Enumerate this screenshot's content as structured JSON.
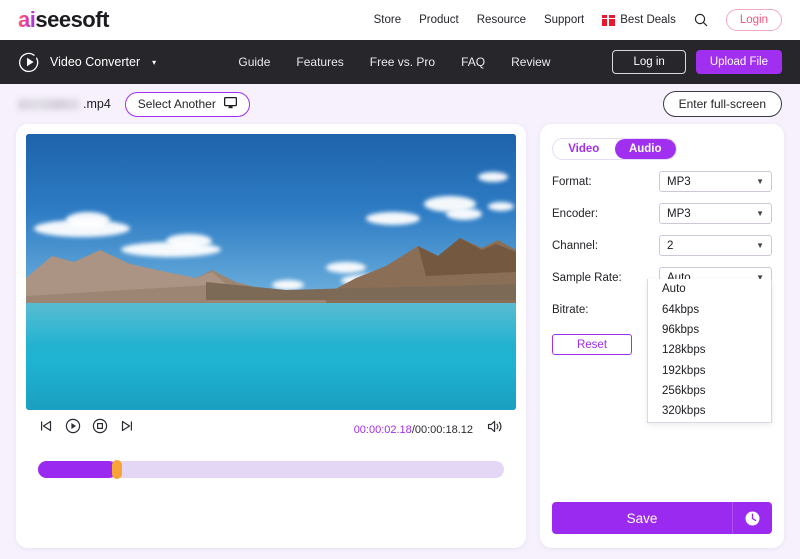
{
  "topbar": {
    "logo_ai": "ai",
    "logo_rest": "seesoft",
    "nav": [
      {
        "label": "Store"
      },
      {
        "label": "Product"
      },
      {
        "label": "Resource"
      },
      {
        "label": "Support"
      }
    ],
    "best_deals": "Best Deals",
    "search_icon": "search-icon",
    "login_label": "Login"
  },
  "darknav": {
    "brand": "Video Converter",
    "caret": "▾",
    "links": [
      {
        "label": "Guide"
      },
      {
        "label": "Features"
      },
      {
        "label": "Free vs. Pro"
      },
      {
        "label": "FAQ"
      },
      {
        "label": "Review"
      }
    ],
    "login_label": "Log in",
    "upload_label": "Upload File"
  },
  "filebar": {
    "filename_suffix": ".mp4",
    "select_another": "Select Another",
    "monitor_icon": "monitor-icon",
    "fullscreen_label": "Enter full-screen"
  },
  "player": {
    "controls": [
      {
        "name": "step-backward-icon"
      },
      {
        "name": "play-icon"
      },
      {
        "name": "stop-icon"
      },
      {
        "name": "step-forward-icon"
      }
    ],
    "current_time": "00:00:02.18",
    "separator": "/",
    "total_time": "00:00:18.12",
    "volume_icon": "volume-icon",
    "tooltip_time": "00:00:02.18",
    "progress_percent": 17
  },
  "settings": {
    "tab_video": "Video",
    "tab_audio": "Audio",
    "active_tab": "Audio",
    "fields": [
      {
        "label": "Format:",
        "value": "MP3"
      },
      {
        "label": "Encoder:",
        "value": "MP3"
      },
      {
        "label": "Channel:",
        "value": "2"
      },
      {
        "label": "Sample Rate:",
        "value": "Auto"
      },
      {
        "label": "Bitrate:",
        "value": "Auto"
      }
    ],
    "reset_label": "Reset",
    "bitrate_options": [
      {
        "label": "Auto"
      },
      {
        "label": "64kbps"
      },
      {
        "label": "96kbps"
      },
      {
        "label": "128kbps"
      },
      {
        "label": "192kbps"
      },
      {
        "label": "256kbps"
      },
      {
        "label": "320kbps"
      }
    ],
    "save_label": "Save",
    "history_icon": "clock-history-icon"
  },
  "colors": {
    "accent_purple": "#a12ff0",
    "progress_fill": "#9b2af0",
    "handle_orange": "#f9a438",
    "page_bg": "#f6f1fc",
    "nav_dark": "#26262b",
    "login_pink": "#f4537f",
    "deals_red": "#e8192c"
  }
}
